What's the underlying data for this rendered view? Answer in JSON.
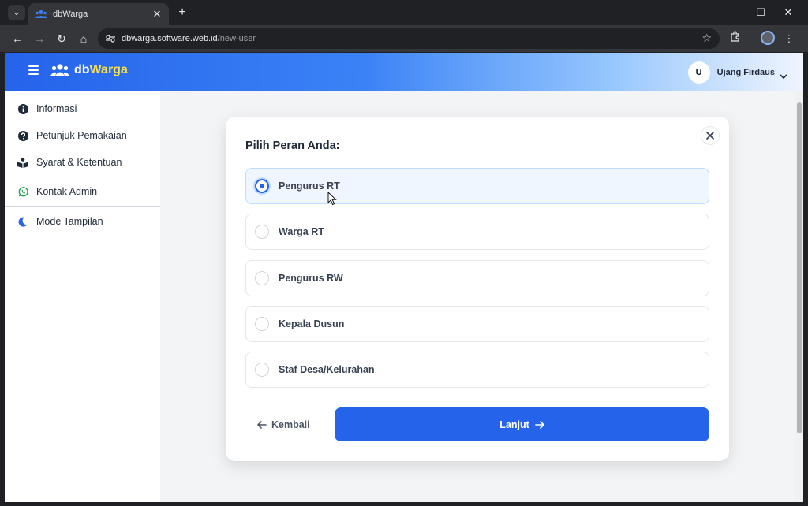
{
  "browser": {
    "tab_title": "dbWarga",
    "url_host": "dbwarga.software.web.id",
    "url_path": "/new-user"
  },
  "header": {
    "brand_db": "db",
    "brand_warga": "Warga",
    "user_initial": "U",
    "user_name": "Ujang Firdaus"
  },
  "sidebar": {
    "items": [
      {
        "label": "Informasi",
        "icon": "info-icon"
      },
      {
        "label": "Petunjuk Pemakaian",
        "icon": "question-icon"
      },
      {
        "label": "Syarat & Ketentuan",
        "icon": "book-reader-icon"
      },
      {
        "label": "Kontak Admin",
        "icon": "whatsapp-icon"
      },
      {
        "label": "Mode Tampilan",
        "icon": "moon-icon"
      }
    ]
  },
  "modal": {
    "title": "Pilih Peran Anda:",
    "options": [
      {
        "label": "Pengurus RT",
        "selected": true
      },
      {
        "label": "Warga RT",
        "selected": false
      },
      {
        "label": "Pengurus RW",
        "selected": false
      },
      {
        "label": "Kepala Dusun",
        "selected": false
      },
      {
        "label": "Staf Desa/Kelurahan",
        "selected": false
      }
    ],
    "back_label": "Kembali",
    "next_label": "Lanjut"
  },
  "colors": {
    "primary": "#2563eb",
    "brand_accent": "#fde047",
    "selected_bg": "#eff6ff"
  }
}
